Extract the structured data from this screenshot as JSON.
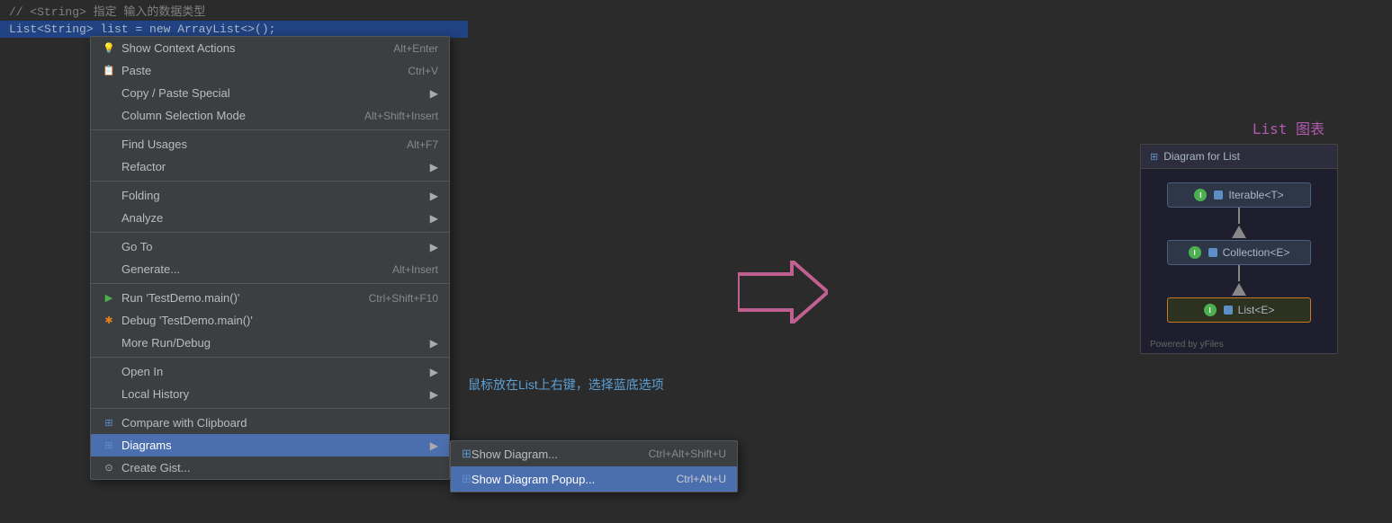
{
  "editor": {
    "lines": [
      {
        "text": "// <String> 指定 输入的数据类型",
        "type": "comment"
      },
      {
        "text": "List<String> list = new ArrayList<>();",
        "type": "highlight"
      }
    ]
  },
  "contextMenu": {
    "items": [
      {
        "id": "show-context-actions",
        "icon": "bulb",
        "label": "Show Context Actions",
        "shortcut": "Alt+Enter",
        "hasArrow": false
      },
      {
        "id": "paste",
        "icon": "paste",
        "label": "Paste",
        "shortcut": "Ctrl+V",
        "hasArrow": false
      },
      {
        "id": "copy-paste-special",
        "icon": "",
        "label": "Copy / Paste Special",
        "shortcut": "",
        "hasArrow": true
      },
      {
        "id": "column-selection-mode",
        "icon": "",
        "label": "Column Selection Mode",
        "shortcut": "Alt+Shift+Insert",
        "hasArrow": false
      },
      {
        "id": "divider1",
        "type": "divider"
      },
      {
        "id": "find-usages",
        "icon": "",
        "label": "Find Usages",
        "shortcut": "Alt+F7",
        "hasArrow": false
      },
      {
        "id": "refactor",
        "icon": "",
        "label": "Refactor",
        "shortcut": "",
        "hasArrow": true
      },
      {
        "id": "divider2",
        "type": "divider"
      },
      {
        "id": "folding",
        "icon": "",
        "label": "Folding",
        "shortcut": "",
        "hasArrow": true
      },
      {
        "id": "analyze",
        "icon": "",
        "label": "Analyze",
        "shortcut": "",
        "hasArrow": true
      },
      {
        "id": "divider3",
        "type": "divider"
      },
      {
        "id": "go-to",
        "icon": "",
        "label": "Go To",
        "shortcut": "",
        "hasArrow": true
      },
      {
        "id": "generate",
        "icon": "",
        "label": "Generate...",
        "shortcut": "Alt+Insert",
        "hasArrow": false
      },
      {
        "id": "divider4",
        "type": "divider"
      },
      {
        "id": "run",
        "icon": "run",
        "label": "Run 'TestDemo.main()'",
        "shortcut": "Ctrl+Shift+F10",
        "hasArrow": false
      },
      {
        "id": "debug",
        "icon": "debug",
        "label": "Debug 'TestDemo.main()'",
        "shortcut": "",
        "hasArrow": false
      },
      {
        "id": "more-run-debug",
        "icon": "",
        "label": "More Run/Debug",
        "shortcut": "",
        "hasArrow": true
      },
      {
        "id": "divider5",
        "type": "divider"
      },
      {
        "id": "open-in",
        "icon": "",
        "label": "Open In",
        "shortcut": "",
        "hasArrow": true
      },
      {
        "id": "local-history",
        "icon": "",
        "label": "Local History",
        "shortcut": "",
        "hasArrow": true
      },
      {
        "id": "divider6",
        "type": "divider"
      },
      {
        "id": "compare-clipboard",
        "icon": "compare",
        "label": "Compare with Clipboard",
        "shortcut": "",
        "hasArrow": false
      },
      {
        "id": "diagrams",
        "icon": "diagrams",
        "label": "Diagrams",
        "shortcut": "",
        "hasArrow": true,
        "active": true
      },
      {
        "id": "create-gist",
        "icon": "gist",
        "label": "Create Gist...",
        "shortcut": "",
        "hasArrow": false
      }
    ]
  },
  "submenu": {
    "items": [
      {
        "id": "show-diagram",
        "icon": "diagrams",
        "label": "Show Diagram...",
        "shortcut": "Ctrl+Alt+Shift+U"
      },
      {
        "id": "show-diagram-popup",
        "icon": "diagrams",
        "label": "Show Diagram Popup...",
        "shortcut": "Ctrl+Alt+U",
        "active": true
      }
    ]
  },
  "annotation": {
    "text": "鼠标放在List上右键，选择蓝底选项"
  },
  "diagramLabel": {
    "text": "List 图表"
  },
  "diagramPanel": {
    "title": "Diagram for List",
    "nodes": [
      {
        "label": "Iterable<T>",
        "selected": false
      },
      {
        "label": "Collection<E>",
        "selected": false
      },
      {
        "label": "List<E>",
        "selected": true
      }
    ],
    "footer": "Powered by yFiles"
  }
}
